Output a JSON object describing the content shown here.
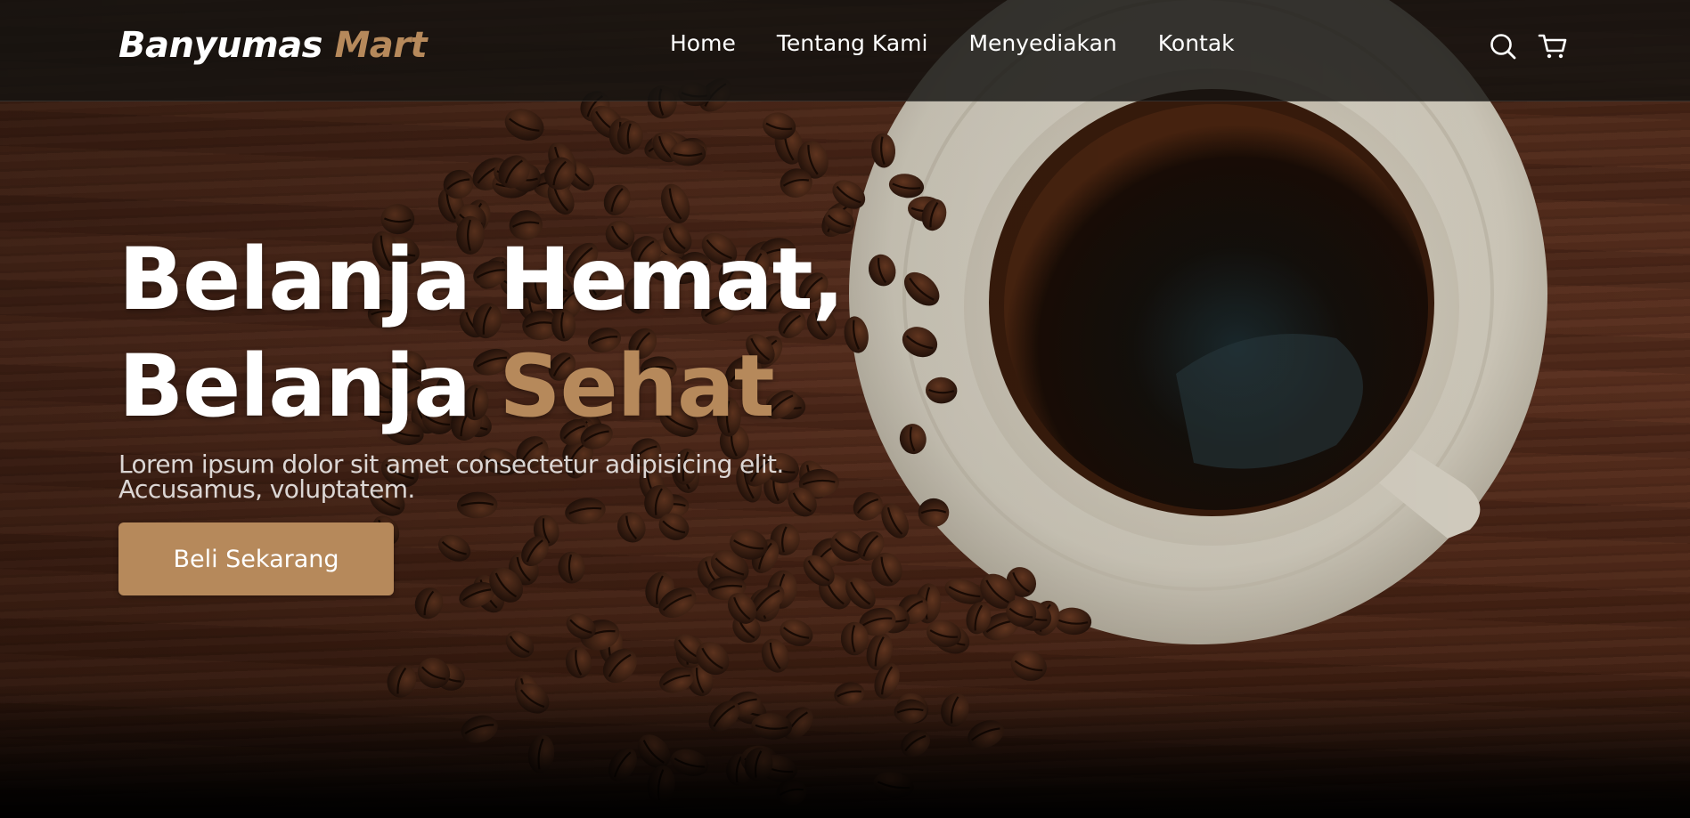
{
  "navbar": {
    "brand_primary": "Banyumas",
    "brand_accent": "Mart",
    "links": [
      "Home",
      "Tentang Kami",
      "Menyediakan",
      "Kontak"
    ],
    "icons": [
      "search-icon",
      "shopping-cart-icon"
    ]
  },
  "hero": {
    "title_line1": "Belanja Hemat,",
    "title_line2_prefix": "Belanja",
    "title_line2_accent": "Sehat",
    "description": "Lorem ipsum dolor sit amet consectetur adipisicing elit. Accusamus, voluptatem.",
    "cta_label": "Beli Sekarang"
  },
  "colors": {
    "accent": "#b6895b",
    "navbar_bg": "#141210",
    "text": "#ffffff"
  }
}
